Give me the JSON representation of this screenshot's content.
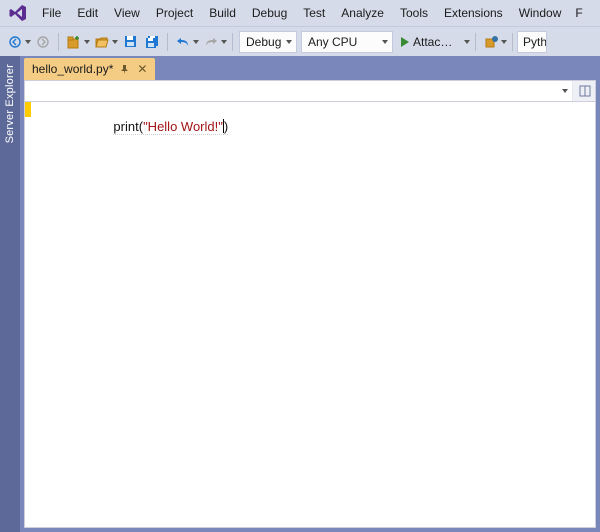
{
  "menu": {
    "file": "File",
    "edit": "Edit",
    "view": "View",
    "project": "Project",
    "build": "Build",
    "debug": "Debug",
    "test": "Test",
    "analyze": "Analyze",
    "tools": "Tools",
    "extensions": "Extensions",
    "window": "Window",
    "trailing": "F"
  },
  "toolbar": {
    "config": "Debug",
    "platform": "Any CPU",
    "attach": "Attach…",
    "python_env": "Pyth"
  },
  "sidebar": {
    "server_explorer": "Server Explorer"
  },
  "tab": {
    "title": "hello_world.py*"
  },
  "code": {
    "fn": "print",
    "open": "(",
    "str": "\"Hello World!\"",
    "close": ")"
  }
}
